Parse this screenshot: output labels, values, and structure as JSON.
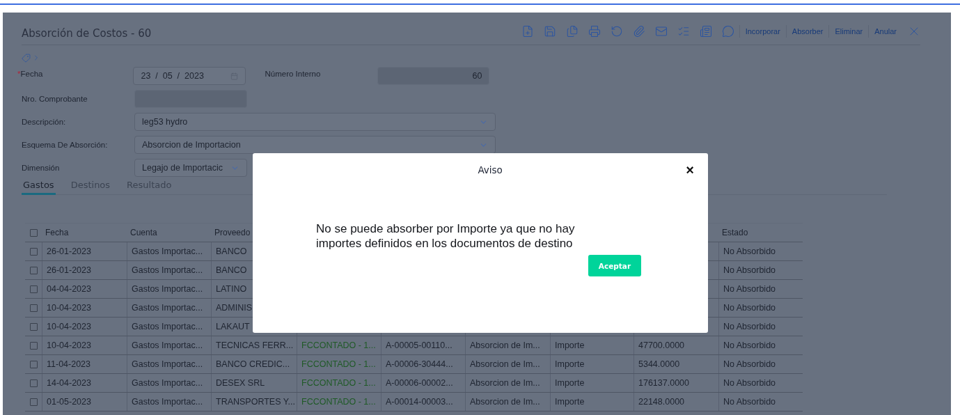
{
  "header": {
    "title": "Absorción de Costos - 60"
  },
  "actions": [
    "Incorporar",
    "Absorber",
    "Eliminar",
    "Anular"
  ],
  "fields": [
    {
      "kind": "date",
      "label": "Fecha",
      "required_mark": "*",
      "value": "23  /  05  /  2023",
      "side_label": "Número Interno",
      "side_value": "60"
    },
    {
      "kind": "readonly",
      "label": "Nro. Comprobante"
    },
    {
      "kind": "select",
      "label": "Descripción:",
      "value": "leg53 hydro"
    },
    {
      "kind": "select",
      "label": "Esquema De Absorción:",
      "value": "Absorcion de Importacion"
    },
    {
      "kind": "select_short",
      "label": "Dimensión",
      "value": "Legajo de Importacic"
    }
  ],
  "tabs": [
    {
      "label": "Gastos",
      "selected": true
    },
    {
      "label": "Destinos",
      "selected": false
    },
    {
      "label": "Resultado",
      "selected": false
    }
  ],
  "table": {
    "header_checked": false,
    "columns": [
      "Fecha",
      "Cuenta",
      "Proveedo",
      "",
      "",
      "",
      "",
      "",
      "Estado"
    ],
    "rows": [
      {
        "checked": false,
        "cells": [
          "26-01-2023",
          "Gastos Importac...",
          "BANCO",
          null,
          null,
          null,
          null,
          null,
          "No Absorbido"
        ]
      },
      {
        "checked": false,
        "cells": [
          "26-01-2023",
          "Gastos Importac...",
          "BANCO",
          null,
          null,
          null,
          null,
          null,
          "No Absorbido"
        ]
      },
      {
        "checked": false,
        "cells": [
          "04-04-2023",
          "Gastos Importac...",
          "LATINO",
          null,
          null,
          null,
          null,
          null,
          "No Absorbido"
        ]
      },
      {
        "checked": false,
        "cells": [
          "10-04-2023",
          "Gastos Importac...",
          "ADMINIS",
          null,
          null,
          null,
          null,
          null,
          "No Absorbido"
        ]
      },
      {
        "checked": false,
        "cells": [
          "10-04-2023",
          "Gastos Importac...",
          "LAKAUT",
          null,
          null,
          null,
          null,
          null,
          "No Absorbido"
        ]
      },
      {
        "checked": false,
        "cells": [
          "10-04-2023",
          "Gastos Importac...",
          "TECNICAS FERR...",
          "FCCONTADO - 1...",
          "A-00005-00110...",
          "Absorcion de Im...",
          "Importe",
          "47700.0000",
          "No Absorbido"
        ]
      },
      {
        "checked": false,
        "cells": [
          "11-04-2023",
          "Gastos Importac...",
          "BANCO CREDIC...",
          "FCCONTADO - 1...",
          "A-00006-30444...",
          "Absorcion de Im...",
          "Importe",
          "5344.0000",
          "No Absorbido"
        ]
      },
      {
        "checked": false,
        "cells": [
          "14-04-2023",
          "Gastos Importac...",
          "DESEX SRL",
          "FCCONTADO - 1...",
          "A-00006-00002...",
          "Absorcion de Im...",
          "Importe",
          "176137.0000",
          "No Absorbido"
        ]
      },
      {
        "checked": false,
        "cells": [
          "01-05-2023",
          "Gastos Importac...",
          "TRANSPORTES Y...",
          "FCCONTADO - 1...",
          "A-00014-00003...",
          "Absorcion de Im...",
          "Importe",
          "22148.0000",
          "No Absorbido"
        ]
      }
    ]
  },
  "dialog": {
    "title": "Aviso",
    "close": "×",
    "message": "No se puede absorber por Importe ya que no hay importes definidos en los documentos de destino",
    "button": "Aceptar"
  }
}
